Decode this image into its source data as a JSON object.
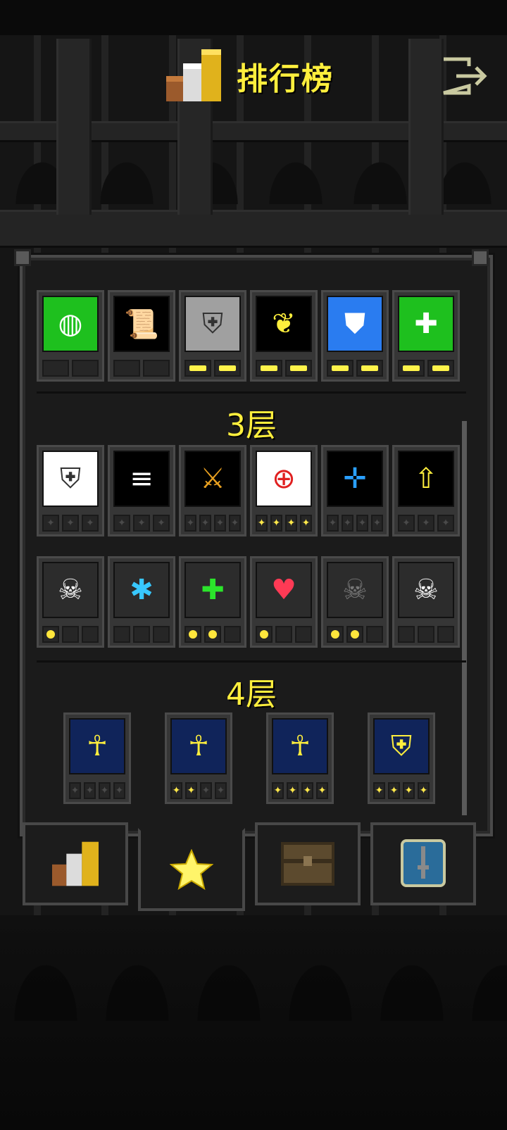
{
  "header": {
    "title": "排行榜",
    "icons": {
      "title_icon": "podium-icon",
      "exit_icon": "exit-icon"
    }
  },
  "floors": [
    {
      "label": "3层"
    },
    {
      "label": "4层"
    }
  ],
  "rows": {
    "row0": [
      {
        "icon": "ring-icon",
        "bg": "#1ec01e",
        "slots": [
          "off",
          "off"
        ]
      },
      {
        "icon": "scroll-icon",
        "bg": "#000000",
        "slots": [
          "off",
          "off"
        ]
      },
      {
        "icon": "armor-upgrade-icon",
        "bg": "#a0a0a0",
        "slots": [
          "on",
          "on"
        ]
      },
      {
        "icon": "scroll-leaf-icon",
        "bg": "#000000",
        "slots": [
          "on",
          "on"
        ]
      },
      {
        "icon": "shield-icon",
        "bg": "#2a7cf0",
        "slots": [
          "on",
          "on"
        ]
      },
      {
        "icon": "wand-plus-icon",
        "bg": "#1ec01e",
        "slots": [
          "on",
          "on"
        ]
      }
    ],
    "row1": [
      {
        "icon": "armor-upgrade-icon",
        "bg": "#ffffff",
        "slots": [
          "dim",
          "dim",
          "dim"
        ]
      },
      {
        "icon": "speed-icon",
        "bg": "#000000",
        "slots": [
          "dim",
          "dim",
          "dim"
        ]
      },
      {
        "icon": "weapon-upgrade-icon",
        "bg": "#000000",
        "slots": [
          "dim",
          "dim",
          "dim",
          "dim"
        ]
      },
      {
        "icon": "target-upgrade-icon",
        "bg": "#ffffff",
        "slots": [
          "star",
          "star",
          "star",
          "star"
        ]
      },
      {
        "icon": "crosshair-upgrade-icon",
        "bg": "#000000",
        "slots": [
          "dim",
          "dim",
          "dim",
          "dim"
        ]
      },
      {
        "icon": "scroll-upgrade-icon",
        "bg": "#000000",
        "slots": [
          "dim",
          "dim",
          "dim"
        ]
      }
    ],
    "row2": [
      {
        "icon": "sword-skull-icon",
        "slots": [
          "dot",
          "off",
          "off"
        ]
      },
      {
        "icon": "sword-frost-icon",
        "slots": [
          "off",
          "off",
          "off"
        ]
      },
      {
        "icon": "sword-heal-icon",
        "slots": [
          "dot",
          "dot",
          "off"
        ]
      },
      {
        "icon": "sword-heart-icon",
        "slots": [
          "dot",
          "off",
          "off"
        ]
      },
      {
        "icon": "sword-dark-skull-icon",
        "slots": [
          "dot",
          "dot",
          "off"
        ]
      },
      {
        "icon": "sword-ghost-icon",
        "slots": [
          "off",
          "off",
          "off"
        ]
      }
    ],
    "row3": [
      {
        "icon": "ankh-plus-icon",
        "slots": [
          "dim",
          "dim",
          "dim",
          "dim"
        ]
      },
      {
        "icon": "ankh-upgrade-icon",
        "slots": [
          "star",
          "star",
          "dim",
          "dim"
        ]
      },
      {
        "icon": "ankh-key-icon",
        "slots": [
          "star",
          "star",
          "star",
          "star"
        ]
      },
      {
        "icon": "armor-cloth-icon",
        "slots": [
          "star",
          "star",
          "star",
          "star"
        ]
      }
    ]
  },
  "tabs": [
    {
      "icon": "podium-icon"
    },
    {
      "icon": "star-icon",
      "active": true
    },
    {
      "icon": "chest-icon"
    },
    {
      "icon": "sword-card-icon"
    }
  ]
}
